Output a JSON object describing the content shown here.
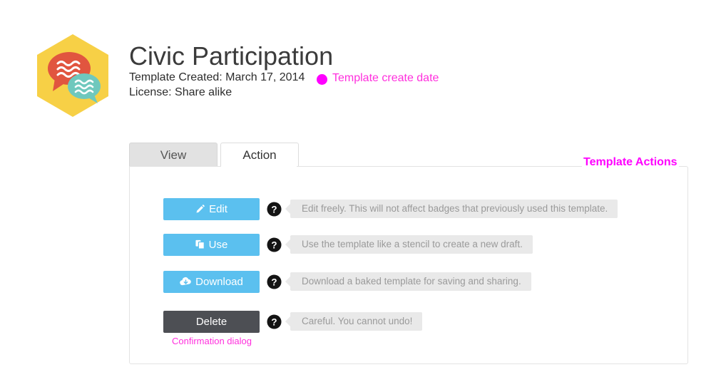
{
  "badge": {
    "icon_name": "civic-participation-badge",
    "hex_color": "#f7d046",
    "speech_bubble_large_color": "#e1553f",
    "speech_bubble_small_color": "#6fc8bd"
  },
  "header": {
    "title": "Civic Participation",
    "created_label": "Template Created: March 17, 2014",
    "license_label": "License: Share alike"
  },
  "annotations": {
    "create_date": "Template create date",
    "template_actions": "Template Actions",
    "confirmation_dialog": "Confirmation dialog",
    "color": "#ff00ff"
  },
  "tabs": [
    {
      "label": "View",
      "active": false
    },
    {
      "label": "Action",
      "active": true
    }
  ],
  "actions": [
    {
      "label": "Edit",
      "icon": "pencil-icon",
      "style": "primary",
      "color": "#5bc0ef",
      "tooltip": "Edit freely. This will not affect badges that previously used this template.",
      "help_icon": "question-mark-circle-icon"
    },
    {
      "label": "Use",
      "icon": "copy-icon",
      "style": "primary",
      "color": "#5bc0ef",
      "tooltip": "Use the template like a stencil to create a new draft.",
      "help_icon": "question-mark-circle-icon"
    },
    {
      "label": "Download",
      "icon": "cloud-download-icon",
      "style": "primary",
      "color": "#5bc0ef",
      "tooltip": "Download a baked template for saving and sharing.",
      "help_icon": "question-mark-circle-icon"
    },
    {
      "label": "Delete",
      "icon": "none",
      "style": "danger",
      "color": "#4d4f54",
      "tooltip": "Careful. You cannot undo!",
      "help_icon": "question-mark-circle-icon"
    }
  ]
}
